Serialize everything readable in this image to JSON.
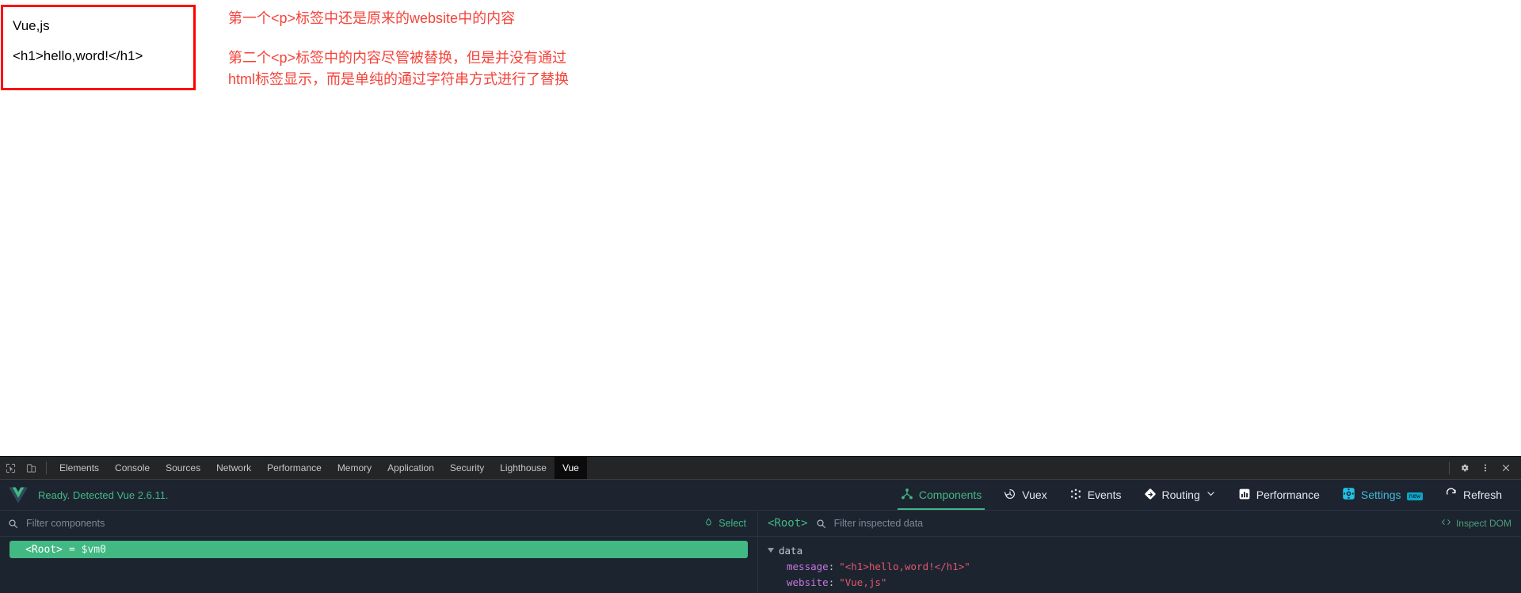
{
  "page": {
    "code_box": {
      "line1": "Vue,js",
      "line2": "<h1>hello,word!</h1>"
    },
    "annotations": {
      "first": "第一个<p>标签中还是原来的website中的内容",
      "second": "第二个<p>标签中的内容尽管被替换，但是并没有通过\nhtml标签显示，而是单纯的通过字符串方式进行了替换"
    },
    "accent_red": "#f4433a"
  },
  "devtools": {
    "tabs": [
      {
        "label": "Elements",
        "active": false
      },
      {
        "label": "Console",
        "active": false
      },
      {
        "label": "Sources",
        "active": false
      },
      {
        "label": "Network",
        "active": false
      },
      {
        "label": "Performance",
        "active": false
      },
      {
        "label": "Memory",
        "active": false
      },
      {
        "label": "Application",
        "active": false
      },
      {
        "label": "Security",
        "active": false
      },
      {
        "label": "Lighthouse",
        "active": false
      },
      {
        "label": "Vue",
        "active": true
      }
    ],
    "left_icons": [
      "inspect-element-icon",
      "device-toolbar-icon"
    ],
    "right_icons": [
      "gear-icon",
      "kebab-menu-icon",
      "close-icon"
    ]
  },
  "vue_panel": {
    "status": "Ready. Detected Vue 2.6.11.",
    "logo": "vue-logo",
    "nav": [
      {
        "label": "Components",
        "icon": "components-icon",
        "active": true
      },
      {
        "label": "Vuex",
        "icon": "vuex-history-icon",
        "active": false
      },
      {
        "label": "Events",
        "icon": "events-icon",
        "active": false
      },
      {
        "label": "Routing",
        "icon": "routing-icon",
        "active": false,
        "chevron": true
      },
      {
        "label": "Performance",
        "icon": "performance-icon",
        "active": false
      },
      {
        "label": "Settings",
        "icon": "settings-icon",
        "active": false,
        "badge": "new"
      },
      {
        "label": "Refresh",
        "icon": "refresh-icon",
        "active": false
      }
    ],
    "components_pane": {
      "filter_placeholder": "Filter components",
      "filter_value": "",
      "select_label": "Select",
      "tree": [
        {
          "name": "<Root>",
          "assign": "= $vm0",
          "selected": true
        }
      ]
    },
    "inspector_pane": {
      "root_label": "<Root>",
      "filter_placeholder": "Filter inspected data",
      "filter_value": "",
      "inspect_dom_label": "Inspect DOM",
      "groups": [
        {
          "name": "data",
          "expanded": true,
          "props": [
            {
              "key": "message",
              "value": "\"<h1>hello,word!</h1>\""
            },
            {
              "key": "website",
              "value": "\"Vue,js\""
            }
          ]
        }
      ]
    },
    "colors": {
      "green": "#42b883",
      "cyan": "#42b8d8",
      "bg": "#1c2430"
    }
  }
}
